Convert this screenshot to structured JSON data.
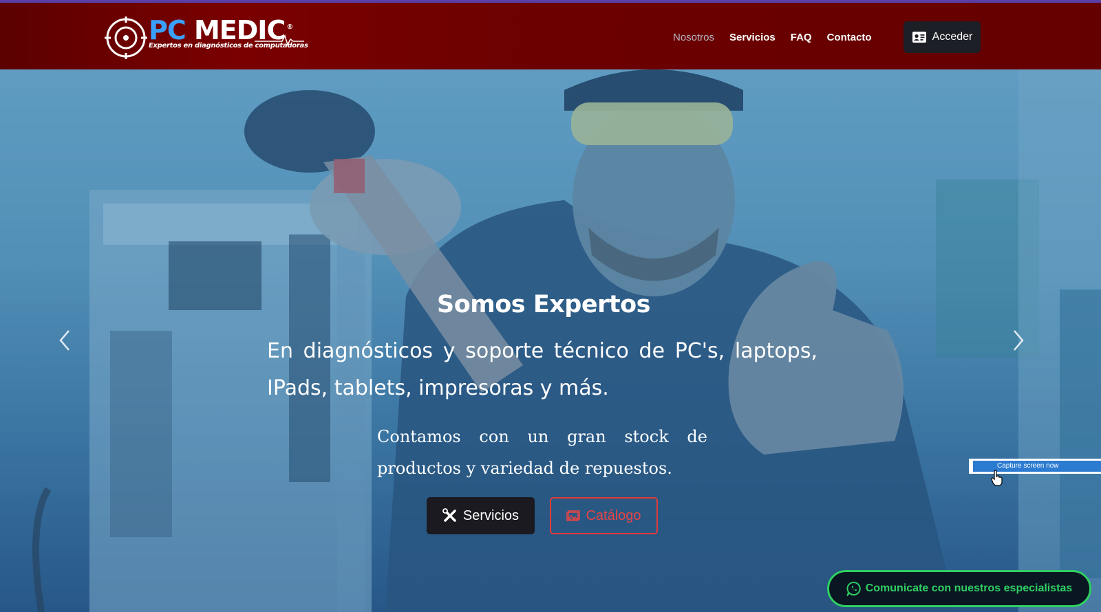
{
  "brand": {
    "name_part1": "PC",
    "name_part2": "MEDIC",
    "registered": "®",
    "tagline": "Expertos en diagnósticos de computadoras"
  },
  "nav": {
    "items": [
      {
        "label": "Nosotros",
        "active": true
      },
      {
        "label": "Servicios",
        "active": false
      },
      {
        "label": "FAQ",
        "active": false
      },
      {
        "label": "Contacto",
        "active": false
      }
    ],
    "login_label": "Acceder"
  },
  "hero": {
    "title": "Somos Expertos",
    "lead": "En diagnósticos y soporte técnico de PC's, laptops, IPads, tablets, impresoras y más.",
    "sub": "Contamos con un gran stock de productos y variedad de repuestos.",
    "btn_servicios": "Servicios",
    "btn_catalogo": "Catálogo"
  },
  "overlay": {
    "capture_label": "Capture screen now"
  },
  "whatsapp": {
    "label": "Comunicate con nuestros especialistas"
  },
  "icons": {
    "logo": "target-crosshair-icon",
    "login": "id-card-icon",
    "servicios": "tools-icon",
    "catalogo": "image-icon",
    "whatsapp": "whatsapp-icon",
    "prev": "chevron-left-icon",
    "next": "chevron-right-icon"
  },
  "colors": {
    "header_bg": "#6d0000",
    "accent_blue": "#3aa0ff",
    "catalog_red": "#e23a3a",
    "whatsapp_green": "#2fcf62",
    "dark_button": "#1d1f26"
  }
}
